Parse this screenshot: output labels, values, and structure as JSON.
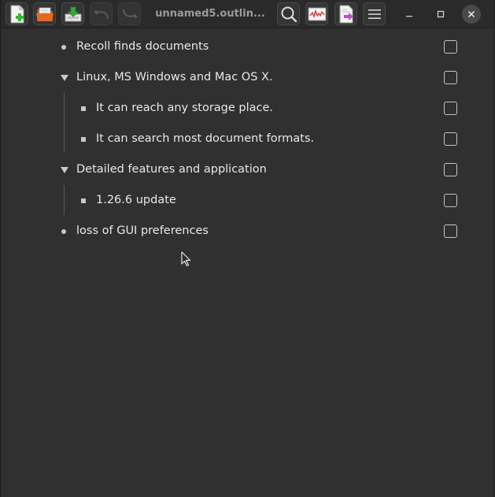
{
  "window": {
    "title": "unnamed5.outlin..."
  },
  "toolbar": {
    "buttons": [
      {
        "icon": "new-file-icon"
      },
      {
        "icon": "open-folder-icon"
      },
      {
        "icon": "save-icon"
      },
      {
        "icon": "undo-icon"
      },
      {
        "icon": "redo-icon"
      },
      {
        "icon": "search-icon"
      },
      {
        "icon": "waveform-icon"
      },
      {
        "icon": "export-icon"
      },
      {
        "icon": "hamburger-menu-icon"
      }
    ]
  },
  "window_controls": {
    "minimize": "minimize-icon",
    "maximize": "maximize-icon",
    "close": "close-icon"
  },
  "outline": {
    "items": [
      {
        "text": "Recoll finds documents",
        "level": 0,
        "marker": "dot",
        "checked": false
      },
      {
        "text": "Linux, MS Windows and Mac OS X.",
        "level": 0,
        "marker": "expanded",
        "checked": false
      },
      {
        "text": "It can reach any storage place.",
        "level": 1,
        "marker": "square",
        "checked": false
      },
      {
        "text": "It can search most document formats.",
        "level": 1,
        "marker": "square",
        "checked": false
      },
      {
        "text": "Detailed features and application",
        "level": 0,
        "marker": "expanded",
        "checked": false
      },
      {
        "text": "1.26.6 update",
        "level": 1,
        "marker": "square",
        "checked": false
      },
      {
        "text": "loss of GUI preferences",
        "level": 0,
        "marker": "dot",
        "checked": false
      }
    ]
  },
  "colors": {
    "background": "#303030",
    "titlebar": "#2a2a2a",
    "text": "#e8e8e8",
    "title_text": "#9b9b9b"
  }
}
